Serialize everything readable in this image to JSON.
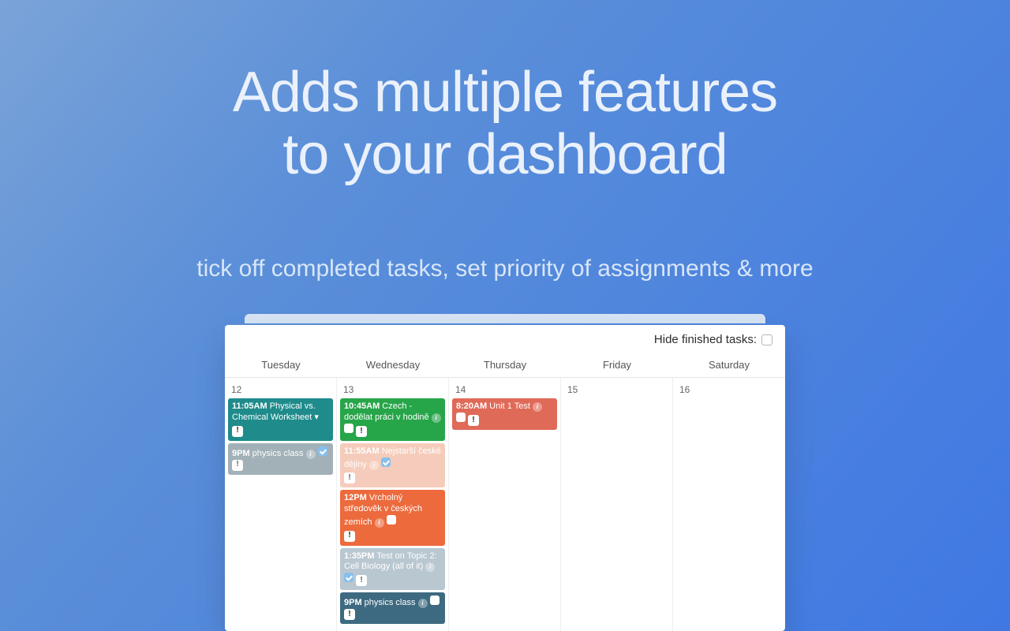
{
  "headline_l1": "Adds multiple features",
  "headline_l2": "to your dashboard",
  "subline": "tick off completed tasks, set priority of assignments & more",
  "hide_label": "Hide finished tasks:",
  "days": [
    "Tuesday",
    "Wednesday",
    "Thursday",
    "Friday",
    "Saturday"
  ],
  "nums": [
    "12",
    "13",
    "14",
    "15",
    "16"
  ],
  "events": {
    "tue": [
      {
        "time": "11:05AM",
        "title": "Physical vs. Chemical Worksheet",
        "color": "c-teal",
        "info": false,
        "chk": false,
        "chk_on": false,
        "bang_below": true,
        "arrow": true
      },
      {
        "time": "9PM",
        "title": "physics class",
        "color": "c-slate",
        "info": true,
        "chk": true,
        "chk_on": true,
        "bang_inline": true,
        "faded": true
      }
    ],
    "wed": [
      {
        "time": "10:45AM",
        "title": "Czech - dodělat práci v hodině",
        "color": "c-green",
        "info": true,
        "chk": true,
        "bang_inline": true
      },
      {
        "time": "11:55AM",
        "title": "Nejstarší české dějiny",
        "color": "c-peach",
        "info": true,
        "chk": true,
        "chk_on": true,
        "bang_below": true,
        "faded": true
      },
      {
        "time": "12PM",
        "title": "Vrcholný středověk v českých zemích",
        "color": "c-orange",
        "info": true,
        "chk": true,
        "bang_below": true
      },
      {
        "time": "1:35PM",
        "title": "Test on Topic 2: Cell Biology (all of it)",
        "color": "c-blue",
        "info": true,
        "chk": true,
        "chk_on": true,
        "bang_inline": true,
        "faded": true
      },
      {
        "time": "9PM",
        "title": "physics class",
        "color": "c-steel",
        "info": true,
        "chk": true,
        "bang_inline": true
      }
    ],
    "thu": [
      {
        "time": "8:20AM",
        "title": "Unit 1 Test",
        "color": "c-coral",
        "info": true,
        "chk": true,
        "bang_inline": true
      }
    ]
  }
}
